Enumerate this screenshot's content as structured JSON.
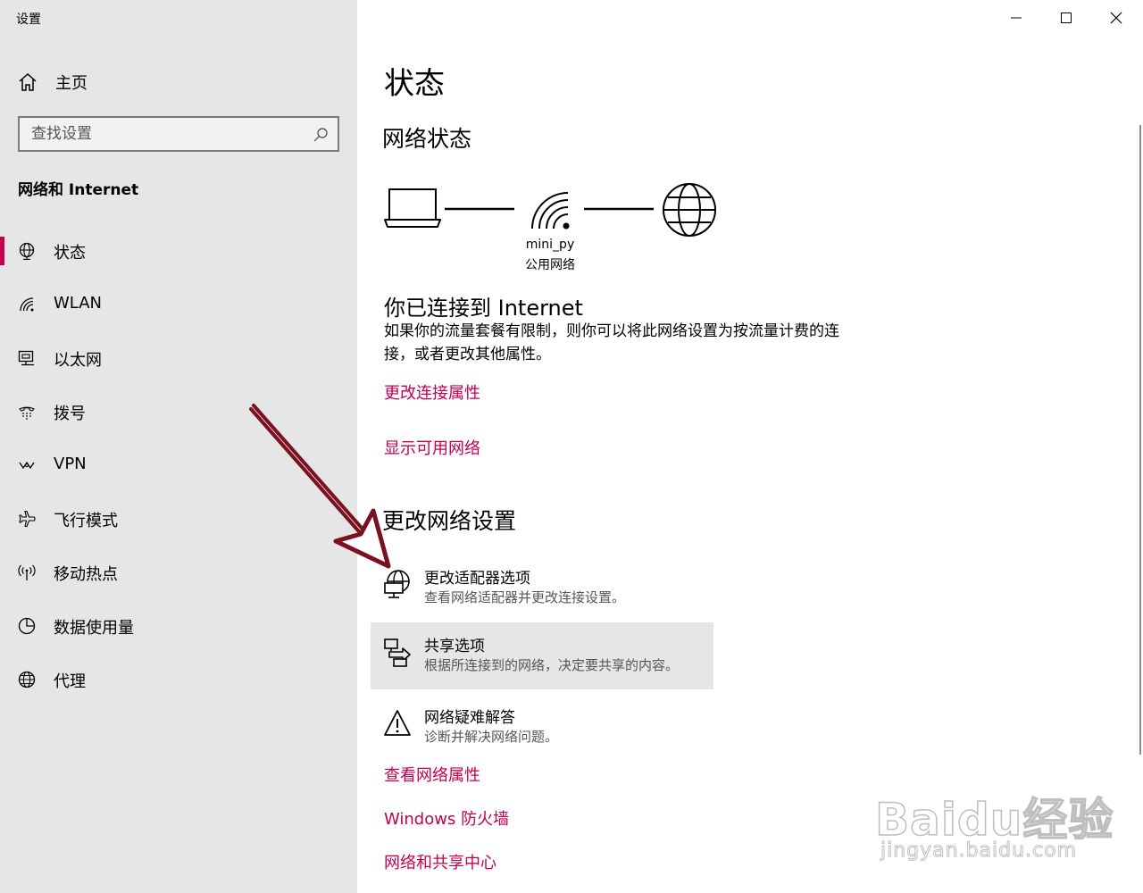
{
  "app": {
    "title": "设置"
  },
  "window_controls": {
    "minimize": "minimize-icon",
    "maximize": "maximize-icon",
    "close": "close-icon"
  },
  "sidebar": {
    "home_label": "主页",
    "search_placeholder": "查找设置",
    "section_title": "网络和 Internet",
    "active_item": "状态",
    "items": [
      {
        "label": "状态",
        "icon": "globe-status-icon"
      },
      {
        "label": "WLAN",
        "icon": "wifi-icon"
      },
      {
        "label": "以太网",
        "icon": "ethernet-icon"
      },
      {
        "label": "拨号",
        "icon": "dialup-icon"
      },
      {
        "label": "VPN",
        "icon": "vpn-icon"
      },
      {
        "label": "飞行模式",
        "icon": "airplane-icon"
      },
      {
        "label": "移动热点",
        "icon": "hotspot-icon"
      },
      {
        "label": "数据使用量",
        "icon": "data-usage-icon"
      },
      {
        "label": "代理",
        "icon": "globe-icon"
      }
    ]
  },
  "main": {
    "title": "状态",
    "network_status_heading": "网络状态",
    "network": {
      "name": "mini_py",
      "type": "公用网络"
    },
    "connected_title": "你已连接到 Internet",
    "connected_desc": "如果你的流量套餐有限制，则你可以将此网络设置为按流量计费的连接，或者更改其他属性。",
    "link_change_props": "更改连接属性",
    "link_show_networks": "显示可用网络",
    "change_settings_heading": "更改网络设置",
    "options": [
      {
        "title": "更改适配器选项",
        "subtitle": "查看网络适配器并更改连接设置。",
        "icon": "adapter-icon"
      },
      {
        "title": "共享选项",
        "subtitle": "根据所连接到的网络，决定要共享的内容。",
        "icon": "sharing-icon"
      },
      {
        "title": "网络疑难解答",
        "subtitle": "诊断并解决网络问题。",
        "icon": "warning-icon"
      }
    ],
    "link_view_props": "查看网络属性",
    "link_firewall": "Windows 防火墙",
    "link_sharing_center": "网络和共享中心"
  },
  "colors": {
    "accent": "#c30052",
    "sidebar_bg": "#e6e6e6",
    "hover_bg": "#e6e6e6",
    "annotation_arrow": "#7b1020"
  },
  "watermark": {
    "brand": "Baidu经验",
    "url": "jingyan.baidu.com"
  }
}
